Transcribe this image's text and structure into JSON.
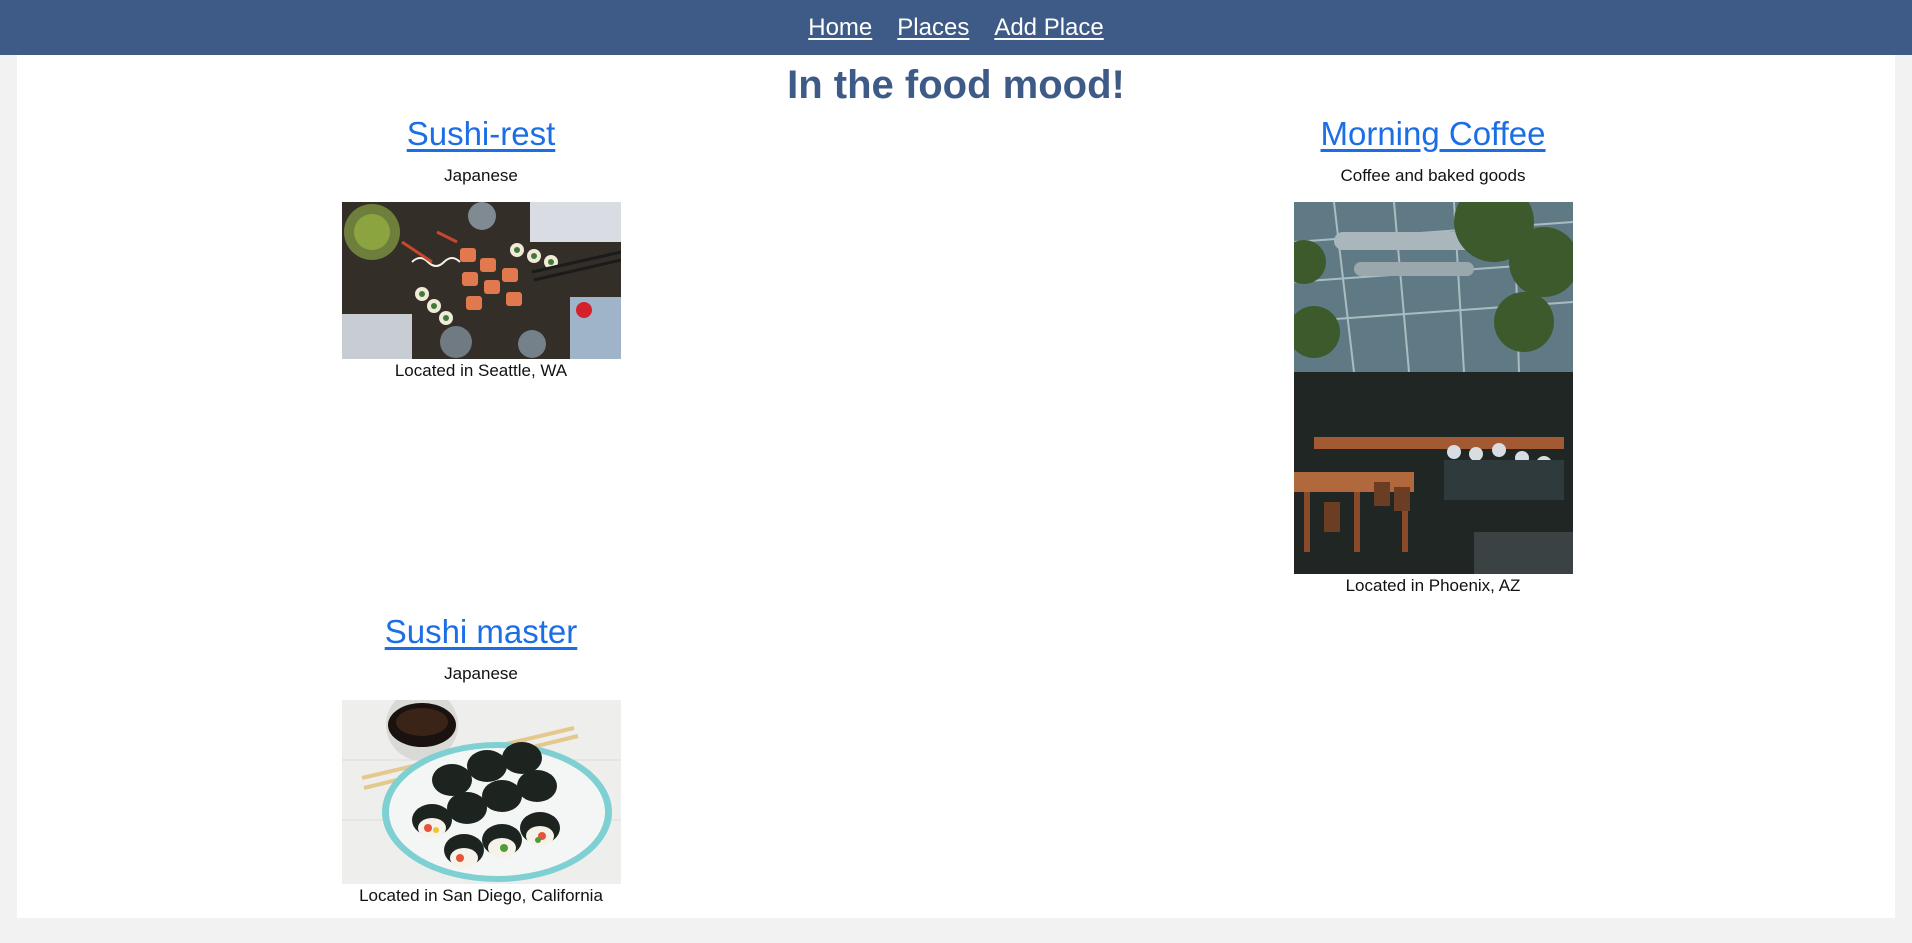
{
  "nav": {
    "items": [
      {
        "label": "Home"
      },
      {
        "label": "Places"
      },
      {
        "label": "Add Place"
      }
    ]
  },
  "main": {
    "title": "In the food mood!"
  },
  "places": [
    {
      "name": "Sushi-rest",
      "cuisine": "Japanese",
      "location": "Located in Seattle, WA",
      "image": "sushi-platter-photo"
    },
    {
      "name": "Morning Coffee",
      "cuisine": "Coffee and baked goods",
      "location": "Located in Phoenix, AZ",
      "image": "greenhouse-cafe-photo"
    },
    {
      "name": "Sushi master",
      "cuisine": "Japanese",
      "location": "Located in San Diego, California",
      "image": "sushi-rolls-plate-photo"
    }
  ],
  "colors": {
    "navbar": "#3e5a86",
    "title": "#3e5a86",
    "link": "#1b6ee6",
    "page_bg": "#f2f2f2",
    "content_bg": "#ffffff"
  }
}
